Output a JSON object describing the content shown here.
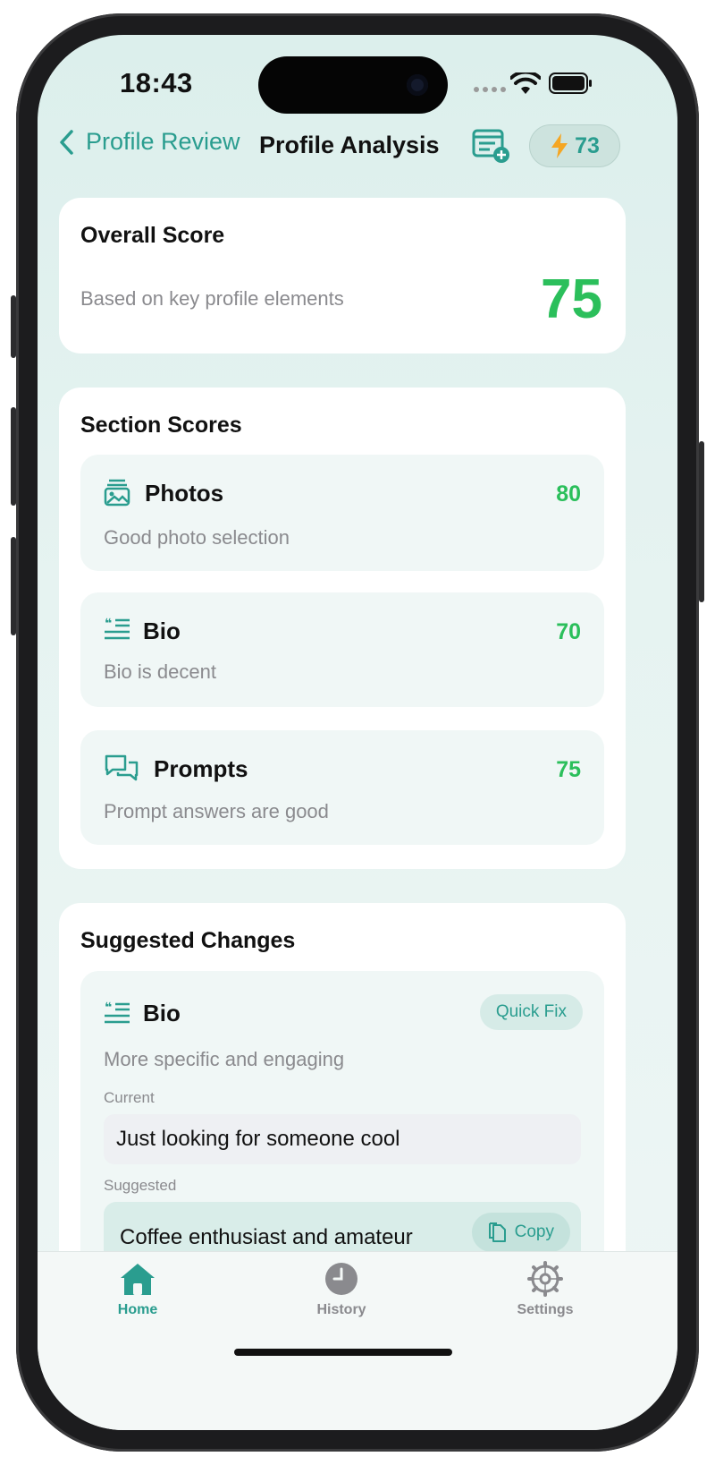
{
  "status_bar": {
    "time": "18:43"
  },
  "nav": {
    "back_label": "Profile Review",
    "title": "Profile Analysis",
    "credits": "73"
  },
  "overall": {
    "title": "Overall Score",
    "subtitle": "Based on key profile elements",
    "score": "75"
  },
  "sections": {
    "title": "Section Scores",
    "items": [
      {
        "name": "Photos",
        "score": "80",
        "description": "Good photo selection",
        "icon": "photo-stack-icon"
      },
      {
        "name": "Bio",
        "score": "70",
        "description": "Bio is decent",
        "icon": "text-quote-icon"
      },
      {
        "name": "Prompts",
        "score": "75",
        "description": "Prompt answers are good",
        "icon": "chat-bubbles-icon"
      }
    ]
  },
  "suggestions": {
    "title": "Suggested Changes",
    "items": [
      {
        "name": "Bio",
        "badge": "Quick Fix",
        "description": "More specific and engaging",
        "current_label": "Current",
        "current_text": "Just looking for someone cool",
        "suggested_label": "Suggested",
        "suggested_text": "Coffee enthusiast and amateur",
        "copy_label": "Copy"
      }
    ]
  },
  "tabs": [
    {
      "label": "Home",
      "icon": "house-icon",
      "active": true
    },
    {
      "label": "History",
      "icon": "clock-icon",
      "active": false
    },
    {
      "label": "Settings",
      "icon": "gear-icon",
      "active": false
    }
  ],
  "colors": {
    "accent": "#2a9d8f",
    "score_green": "#2bbf5b",
    "credit_bolt": "#f5a623"
  }
}
